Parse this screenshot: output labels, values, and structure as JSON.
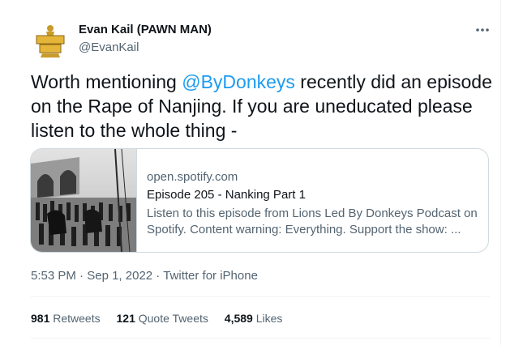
{
  "tweet": {
    "author_name": "Evan Kail (PAWN MAN)",
    "author_handle": "@EvanKail",
    "more_icon": "more-horizontal-icon",
    "text_before": "Worth mentioning ",
    "mention": "@ByDonkeys",
    "text_after": " recently did an episode on the Rape of Nanjing. If you are uneducated please listen to the whole thing -",
    "link_card": {
      "domain": "open.spotify.com",
      "title": "Episode 205 - Nanking Part 1",
      "description": "Listen to this episode from Lions Led By Donkeys Podcast on Spotify. Content warning: Everything. Support the show: ..."
    },
    "time": "5:53 PM",
    "date": "Sep 1, 2022",
    "source": "Twitter for iPhone",
    "separator": " · ",
    "stats": {
      "retweets_count": "981",
      "retweets_label": "Retweets",
      "quotes_count": "121",
      "quotes_label": "Quote Tweets",
      "likes_count": "4,589",
      "likes_label": "Likes"
    }
  },
  "avatar_logo_text": [
    "PAWN",
    "MAN"
  ],
  "colors": {
    "accent": "#1d9bf0",
    "secondary_text": "#536471",
    "border": "#cfd9de"
  }
}
